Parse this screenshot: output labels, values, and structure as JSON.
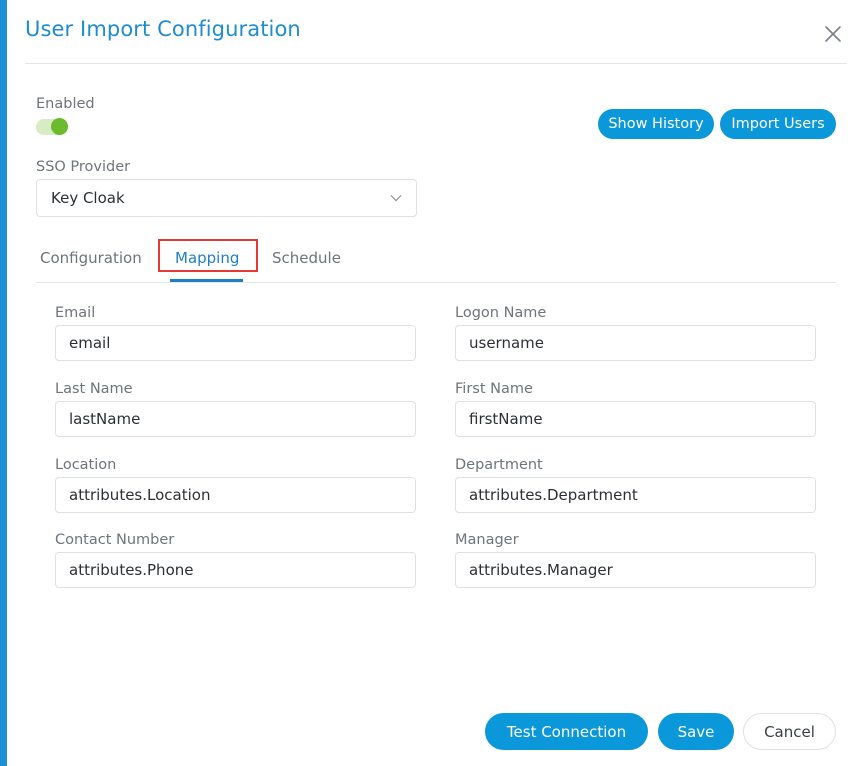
{
  "dialog": {
    "title": "User Import Configuration",
    "close_icon": "close-icon"
  },
  "enabled": {
    "label": "Enabled",
    "value": true
  },
  "actions": {
    "show_history": "Show History",
    "import_users": "Import Users"
  },
  "sso": {
    "label": "SSO Provider",
    "value": "Key Cloak",
    "icon": "chevron-down-icon"
  },
  "tabs": [
    {
      "label": "Configuration",
      "active": false
    },
    {
      "label": "Mapping",
      "active": true
    },
    {
      "label": "Schedule",
      "active": false
    }
  ],
  "mapping": {
    "email": {
      "label": "Email",
      "value": "email"
    },
    "logon_name": {
      "label": "Logon Name",
      "value": "username"
    },
    "last_name": {
      "label": "Last Name",
      "value": "lastName"
    },
    "first_name": {
      "label": "First Name",
      "value": "firstName"
    },
    "location": {
      "label": "Location",
      "value": "attributes.Location"
    },
    "department": {
      "label": "Department",
      "value": "attributes.Department"
    },
    "contact_number": {
      "label": "Contact Number",
      "value": "attributes.Phone"
    },
    "manager": {
      "label": "Manager",
      "value": "attributes.Manager"
    }
  },
  "footer": {
    "test_connection": "Test Connection",
    "save": "Save",
    "cancel": "Cancel"
  },
  "colors": {
    "accent": "#0a98da",
    "toggle_on": "#6cba2e",
    "highlight": "#e53935"
  }
}
